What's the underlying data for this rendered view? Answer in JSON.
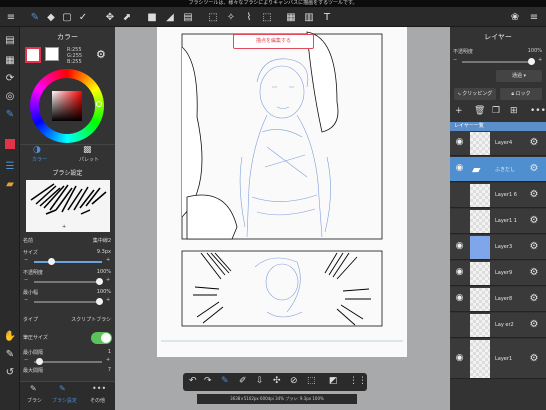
{
  "status_bar": {
    "text": "ブラシツールは、様々なブラシによりキャンバスに描画をするツールです。"
  },
  "color_panel": {
    "title": "カラー",
    "r": "R:255",
    "g": "G:255",
    "b": "B:255",
    "tab_color": "カラー",
    "tab_palette": "パレット"
  },
  "brush_panel": {
    "title": "ブラシ設定",
    "name_label": "名前",
    "name_value": "集中線2",
    "size_label": "サイズ",
    "size_value": "9.3px",
    "size_level": 0.25,
    "opacity_label": "不透明度",
    "opacity_value": "100%",
    "opacity_level": 1.0,
    "min_width_label": "最小幅",
    "min_width_value": "100%",
    "min_width_level": 1.0,
    "type_label": "タイプ",
    "type_value": "スクリプトブラシ",
    "pressure_label": "筆圧サイズ",
    "min_interval_label": "最小間隔",
    "min_interval_value": "1",
    "max_interval_label": "最大間隔",
    "max_interval_value": "7"
  },
  "bottom_tabs": [
    {
      "label": "ブラシ"
    },
    {
      "label": "ブラシ設定"
    },
    {
      "label": "その他"
    }
  ],
  "canvas": {
    "button_label": "描点を編集する"
  },
  "canvas_status": "3638×5102px 600dpi 34% ブラシ: 9.3px 100%",
  "layer_panel": {
    "title": "レイヤー",
    "opacity_label": "不透明度",
    "opacity_value": "100%",
    "blend_mode": "通過",
    "clipping_label": "クリッピング",
    "lock_label": "ロック",
    "list_header": "レイヤー一覧",
    "layers": [
      {
        "name": "Layer4"
      },
      {
        "name": "ふきだし"
      },
      {
        "name": "Layer1 6"
      },
      {
        "name": "Layer1 1"
      },
      {
        "name": "Layer3"
      },
      {
        "name": "Layer9"
      },
      {
        "name": "Layer8"
      },
      {
        "name": "Lay er2"
      },
      {
        "name": "Layer1"
      }
    ]
  },
  "colors": {
    "accent": "#4a90d9",
    "selected_layer": "#4f8fd0",
    "toggle_on": "#5ac45a"
  }
}
